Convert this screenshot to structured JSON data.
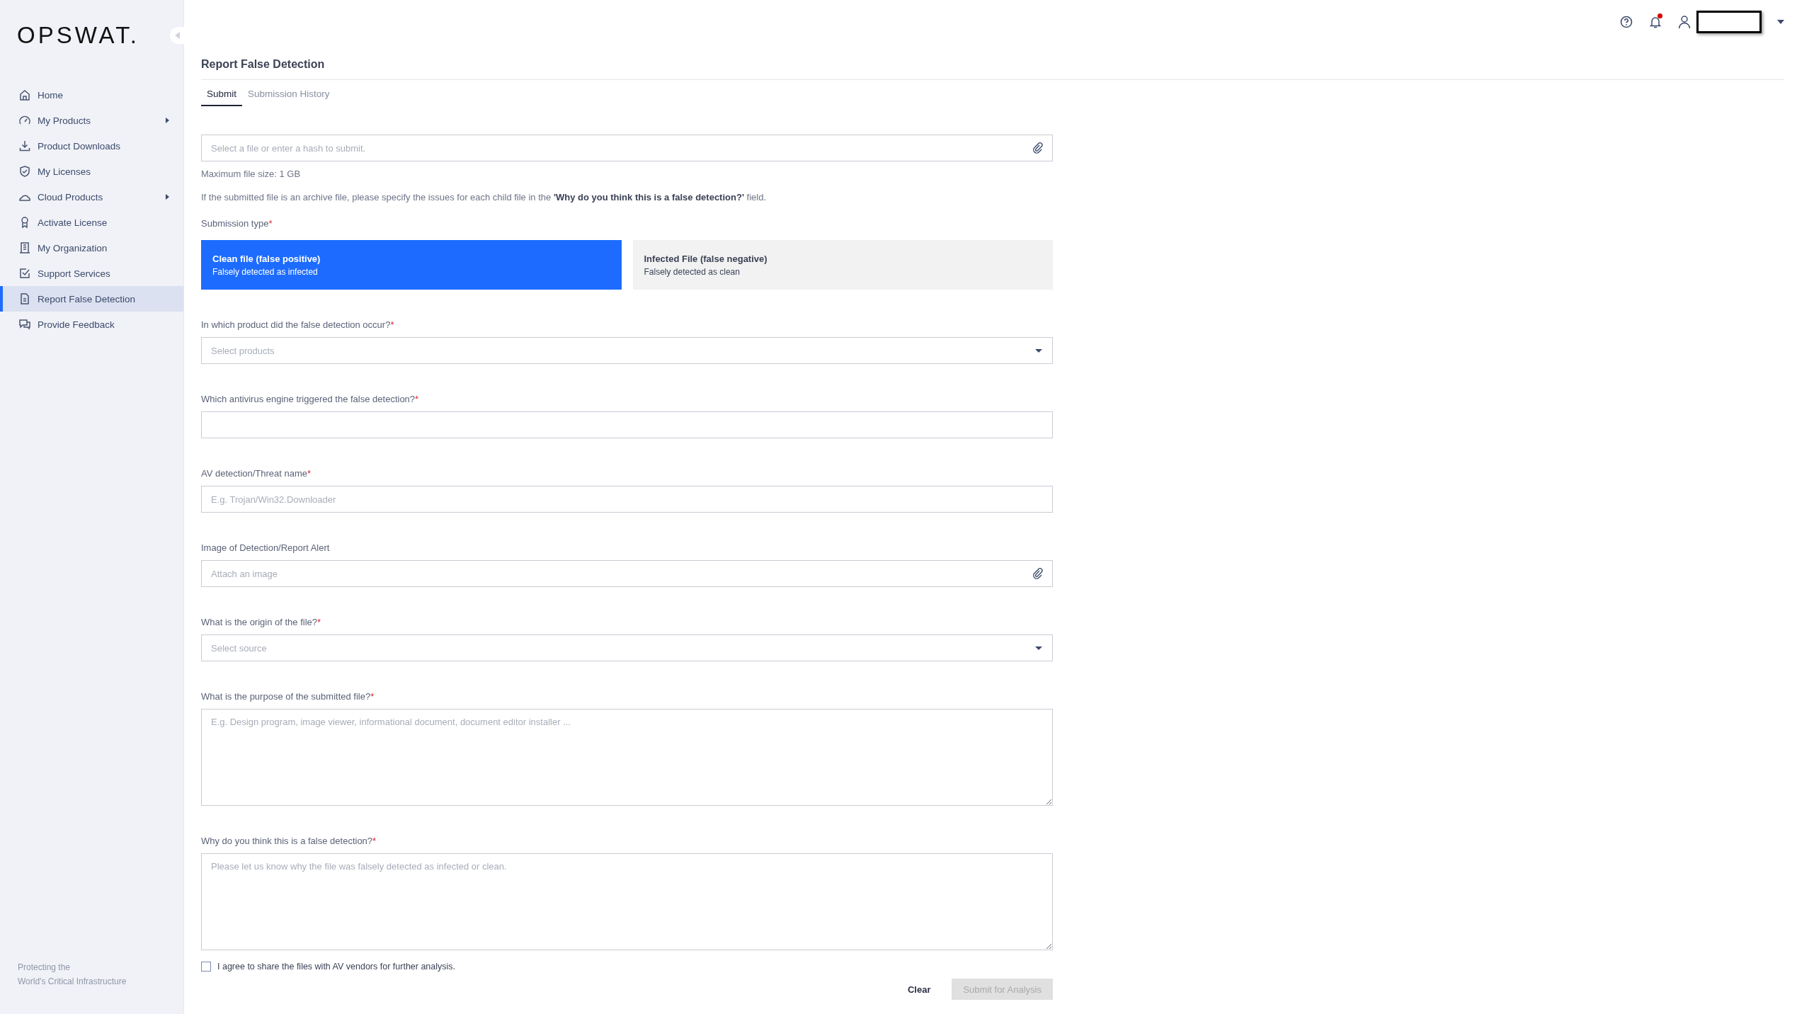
{
  "sidebar": {
    "logo": "OPSWAT.",
    "items": [
      {
        "label": "Home",
        "has_submenu": false,
        "selected": false
      },
      {
        "label": "My Products",
        "has_submenu": true,
        "selected": false
      },
      {
        "label": "Product Downloads",
        "has_submenu": false,
        "selected": false
      },
      {
        "label": "My Licenses",
        "has_submenu": false,
        "selected": false
      },
      {
        "label": "Cloud Products",
        "has_submenu": true,
        "selected": false
      },
      {
        "label": "Activate License",
        "has_submenu": false,
        "selected": false
      },
      {
        "label": "My Organization",
        "has_submenu": false,
        "selected": false
      },
      {
        "label": "Support Services",
        "has_submenu": false,
        "selected": false
      },
      {
        "label": "Report False Detection",
        "has_submenu": false,
        "selected": true
      },
      {
        "label": "Provide Feedback",
        "has_submenu": false,
        "selected": false
      }
    ],
    "footer": [
      "Protecting the",
      "World's Critical Infrastructure"
    ]
  },
  "header": {
    "notifications_unread": true
  },
  "page": {
    "title": "Report False Detection",
    "tabs": [
      {
        "label": "Submit",
        "selected": true
      },
      {
        "label": "Submission History",
        "selected": false
      }
    ],
    "file_field": {
      "placeholder": "Select a file or enter a hash to submit."
    },
    "max_size": "Maximum file size: 1 GB",
    "note": "If the submitted file is an archive file, please specify the issues for each child file in the **'Why do you think this is a false detection?'** field.",
    "submission_type": {
      "label": "Submission type",
      "mark": "*",
      "options": [
        {
          "title": "Clean file (false positive)",
          "subtitle": "Falsely detected as infected",
          "selected": true
        },
        {
          "title": "Infected File (false negative)",
          "subtitle": "Falsely detected as clean",
          "selected": false
        }
      ]
    },
    "fields": [
      {
        "kind": "select",
        "label": "In which product did the false detection occur?",
        "mark": "*",
        "placeholder": "Select products"
      },
      {
        "kind": "text",
        "label": "Which antivirus engine triggered the false detection?",
        "mark": "*"
      },
      {
        "kind": "text",
        "label": "AV detection/Threat name",
        "mark": "*",
        "placeholder": "E.g. Trojan/Win32.Downloader"
      },
      {
        "kind": "attach",
        "label": "Image of Detection/Report Alert",
        "placeholder": "Attach an image"
      },
      {
        "kind": "select",
        "label": "What is the origin of the file?",
        "mark": "*",
        "placeholder": "Select source"
      },
      {
        "kind": "textarea",
        "label": "What is the purpose of the submitted file?",
        "mark": "*",
        "placeholder": "E.g. Design program, image viewer, informational document, document editor installer ..."
      },
      {
        "kind": "textarea",
        "label": "Why do you think this is a false detection?",
        "mark": "*",
        "placeholder": "Please let us know why the file was falsely detected as infected or clean."
      }
    ],
    "agree": {
      "label": "I agree to share the files with AV vendors for further analysis.",
      "checked": false
    },
    "buttons": {
      "clear": "Clear",
      "submit": {
        "label": "Submit for Analysis",
        "disabled": true
      }
    }
  }
}
